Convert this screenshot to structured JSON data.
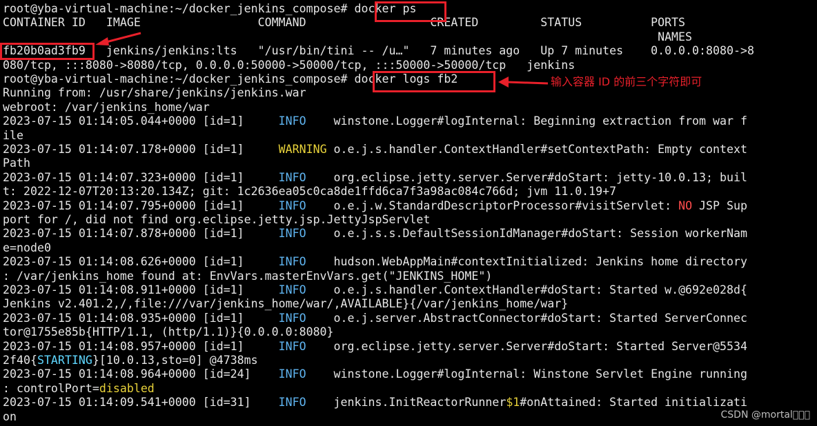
{
  "terminal": {
    "prompt1": "root@yba-virtual-machine:~/docker_jenkins_compose#",
    "cmd1": "docker ps",
    "header1": "CONTAINER ID   IMAGE                 COMMAND                  CREATED         STATUS          PORTS",
    "header2": "                                                                                               NAMES",
    "container_id": "fb20b0ad3fb9",
    "row1_rest": "   jenkins/jenkins:lts   \"/usr/bin/tini -- /u…\"   7 minutes ago   Up 7 minutes    0.0.0.0:8080->8",
    "row2": "080/tcp, :::8080->8080/tcp, 0.0.0.0:50000->50000/tcp, :::50000->50000/tcp   jenkins",
    "prompt2": "root@yba-virtual-machine:~/docker_jenkins_compose#",
    "cmd2": "docker logs fb2",
    "annotation": "输入容器 ID 的前三个字符即可",
    "log": [
      {
        "text": "Running from: /usr/share/jenkins/jenkins.war"
      },
      {
        "text": "webroot: /var/jenkins_home/war"
      },
      {
        "pre": "2023-07-15 01:14:05.044+0000 [id=1]     ",
        "level": "INFO",
        "cls": "info",
        "post": "    winstone.Logger#logInternal: Beginning extraction from war f"
      },
      {
        "text": "ile"
      },
      {
        "pre": "2023-07-15 01:14:07.178+0000 [id=1]     ",
        "level": "WARNING",
        "cls": "warn",
        "post": " o.e.j.s.handler.ContextHandler#setContextPath: Empty context"
      },
      {
        "text": "Path"
      },
      {
        "pre": "2023-07-15 01:14:07.323+0000 [id=1]     ",
        "level": "INFO",
        "cls": "info",
        "post": "    org.eclipse.jetty.server.Server#doStart: jetty-10.0.13; buil"
      },
      {
        "text": "t: 2022-12-07T20:13:20.134Z; git: 1c2636ea05c0ca8de1ffd6ca7f3a98ac084c766d; jvm 11.0.19+7"
      },
      {
        "pre": "2023-07-15 01:14:07.795+0000 [id=1]     ",
        "level": "INFO",
        "cls": "info",
        "post": "    o.e.j.w.StandardDescriptorProcessor#visitServlet: ",
        "hl": "NO",
        "hlcls": "red",
        "post2": " JSP Sup"
      },
      {
        "text": "port for /, did not find org.eclipse.jetty.jsp.JettyJspServlet"
      },
      {
        "pre": "2023-07-15 01:14:07.878+0000 [id=1]     ",
        "level": "INFO",
        "cls": "info",
        "post": "    o.e.j.s.s.DefaultSessionIdManager#doStart: Session workerNam"
      },
      {
        "text": "e=node0"
      },
      {
        "pre": "2023-07-15 01:14:08.626+0000 [id=1]     ",
        "level": "INFO",
        "cls": "info",
        "post": "    hudson.WebAppMain#contextInitialized: Jenkins home directory"
      },
      {
        "text": ": /var/jenkins_home found at: EnvVars.masterEnvVars.get(\"JENKINS_HOME\")"
      },
      {
        "pre": "2023-07-15 01:14:08.911+0000 [id=1]     ",
        "level": "INFO",
        "cls": "info",
        "post": "    o.e.j.s.handler.ContextHandler#doStart: Started w.@692e028d{"
      },
      {
        "text": "Jenkins v2.401.2,/,file:///var/jenkins_home/war/,AVAILABLE}{/var/jenkins_home/war}"
      },
      {
        "pre": "2023-07-15 01:14:08.935+0000 [id=1]     ",
        "level": "INFO",
        "cls": "info",
        "post": "    o.e.j.server.AbstractConnector#doStart: Started ServerConnec"
      },
      {
        "text": "tor@1755e85b{HTTP/1.1, (http/1.1)}{0.0.0.0:8080}"
      },
      {
        "pre": "2023-07-15 01:14:08.957+0000 [id=1]     ",
        "level": "INFO",
        "cls": "info",
        "post": "    org.eclipse.jetty.server.Server#doStart: Started Server@5534"
      },
      {
        "pre": "2f40{",
        "level": "STARTING",
        "cls": "cyan",
        "post": "}[10.0.13,sto=0] @4738ms"
      },
      {
        "pre": "2023-07-15 01:14:08.964+0000 [id=24]    ",
        "level": "INFO",
        "cls": "info",
        "post": "    winstone.Logger#logInternal: Winstone Servlet Engine running"
      },
      {
        "pre": ": controlPort=",
        "level": "disabled",
        "cls": "warn",
        "post": ""
      },
      {
        "pre": "2023-07-15 01:14:09.541+0000 [id=31]    ",
        "level": "INFO",
        "cls": "info",
        "post": "    jenkins.InitReactorRunner",
        "hl": "$1",
        "hlcls": "warn",
        "post2": "#onAttained: Started initializati"
      },
      {
        "text": "on"
      }
    ],
    "watermark": "CSDN @mortal\u0000\u0000\u0000"
  }
}
